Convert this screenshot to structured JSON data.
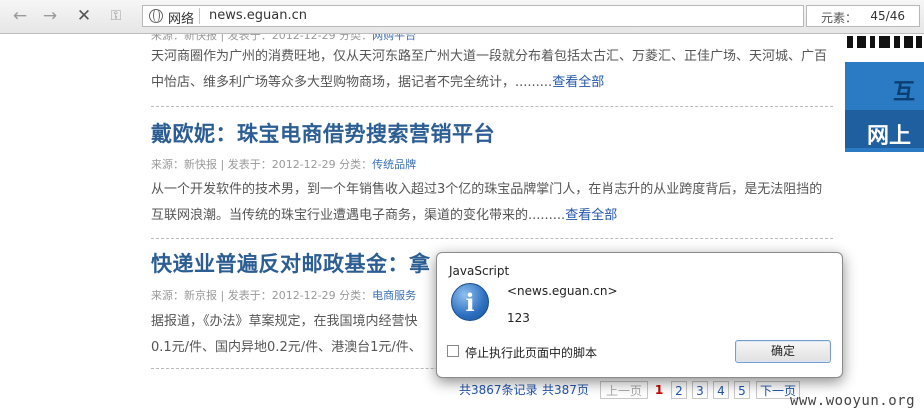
{
  "browser": {
    "zone_label": "网络",
    "url": "news.eguan.cn",
    "elements_label": "元素：",
    "elements_count": "45/46"
  },
  "articles": [
    {
      "meta_source": "来源：新快报",
      "meta_date": "| 发表于：2012-12-29 分类：",
      "meta_category": "网购平台",
      "excerpt": "天河商圈作为广州的消费旺地，仅从天河东路至广州大道一段就分布着包括太古汇、万菱汇、正佳广场、天河城、广百中怡店、维多利广场等众多大型购物商场，据记者不完全统计，.........",
      "more": "查看全部"
    },
    {
      "title": "戴欧妮：珠宝电商借势搜索营销平台",
      "meta_source": "来源：新快报",
      "meta_date": "| 发表于：2012-12-29 分类：",
      "meta_category": "传统品牌",
      "excerpt": "从一个开发软件的技术男，到一个年销售收入超过3个亿的珠宝品牌掌门人，在肖志升的从业跨度背后，是无法阻挡的互联网浪潮。当传统的珠宝行业遭遇电子商务，渠道的变化带来的.........",
      "more": "查看全部"
    },
    {
      "title": "快递业普遍反对邮政基金：拿",
      "meta_source": "来源：新京报",
      "meta_date": "| 发表于：2012-12-29 分类：",
      "meta_category": "电商服务",
      "excerpt_line1": "据报道，《办法》草案规定，在我国境内经营快",
      "excerpt_line2": "0.1元/件、国内异地0.2元/件、港澳台1元/件、"
    }
  ],
  "pagination": {
    "total_records": "共3867条记录",
    "total_pages": "共387页",
    "prev": "上一页",
    "pages": [
      "1",
      "2",
      "3",
      "4",
      "5"
    ],
    "current": "1",
    "next": "下一页"
  },
  "dialog": {
    "title": "JavaScript",
    "icon": "info-icon",
    "origin": "<news.eguan.cn>",
    "message": "123",
    "checkbox_label": "停止执行此页面中的脚本",
    "checkbox_checked": false,
    "ok_label": "确定"
  },
  "sidebar_ad": {
    "text_top": "互",
    "text_bottom": "网上"
  },
  "watermark": "www.wooyun.org"
}
